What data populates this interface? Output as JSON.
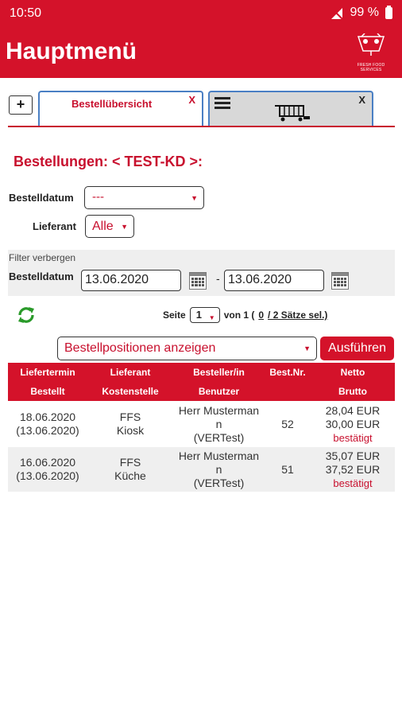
{
  "status_bar": {
    "time": "10:50",
    "battery": "99 %"
  },
  "app": {
    "title": "Hauptmenü",
    "logo_text": "FRESH FOOD SERVICES"
  },
  "tabs": {
    "add_label": "+",
    "active": {
      "label": "Bestellübersicht",
      "close": "X"
    },
    "second": {
      "close": "X"
    }
  },
  "heading": "Bestellungen: < TEST-KD >:",
  "filters": {
    "bestelldatum_label": "Bestelldatum",
    "bestelldatum_value": "---",
    "lieferant_label": "Lieferant",
    "lieferant_value": "Alle",
    "toggle_label": "Filter verbergen",
    "range_label": "Bestelldatum",
    "date_from": "13.06.2020",
    "date_to": "13.06.2020",
    "range_sep": "-"
  },
  "pager": {
    "seite": "Seite",
    "page": "1",
    "von": "von 1 (",
    "selected": "0",
    "saetze": "/ 2 Sätze sel.)"
  },
  "action": {
    "select": "Bestellpositionen anzeigen",
    "run": "Ausführen"
  },
  "table": {
    "headers_top": [
      "Liefertermin",
      "Lieferant",
      "Besteller/in",
      "Best.Nr.",
      "Netto"
    ],
    "headers_bottom": [
      "Bestellt",
      "Kostenstelle",
      "Benutzer",
      "",
      "Brutto"
    ],
    "rows": [
      {
        "liefertermin": "18.06.2020",
        "bestellt": "(13.06.2020)",
        "lieferant": "FFS",
        "kostenstelle": "Kiosk",
        "besteller_1": "Herr Musterman",
        "besteller_2": "n",
        "benutzer": "(VERTest)",
        "nr": "52",
        "netto": "28,04 EUR",
        "brutto": "30,00 EUR",
        "status": "bestätigt"
      },
      {
        "liefertermin": "16.06.2020",
        "bestellt": "(13.06.2020)",
        "lieferant": "FFS",
        "kostenstelle": "Küche",
        "besteller_1": "Herr Musterman",
        "besteller_2": "n",
        "benutzer": "(VERTest)",
        "nr": "51",
        "netto": "35,07 EUR",
        "brutto": "37,52 EUR",
        "status": "bestätigt"
      }
    ]
  },
  "colors": {
    "brand": "#d4122a",
    "tab_border": "#4a7fc4",
    "row_alt": "#efefef"
  }
}
